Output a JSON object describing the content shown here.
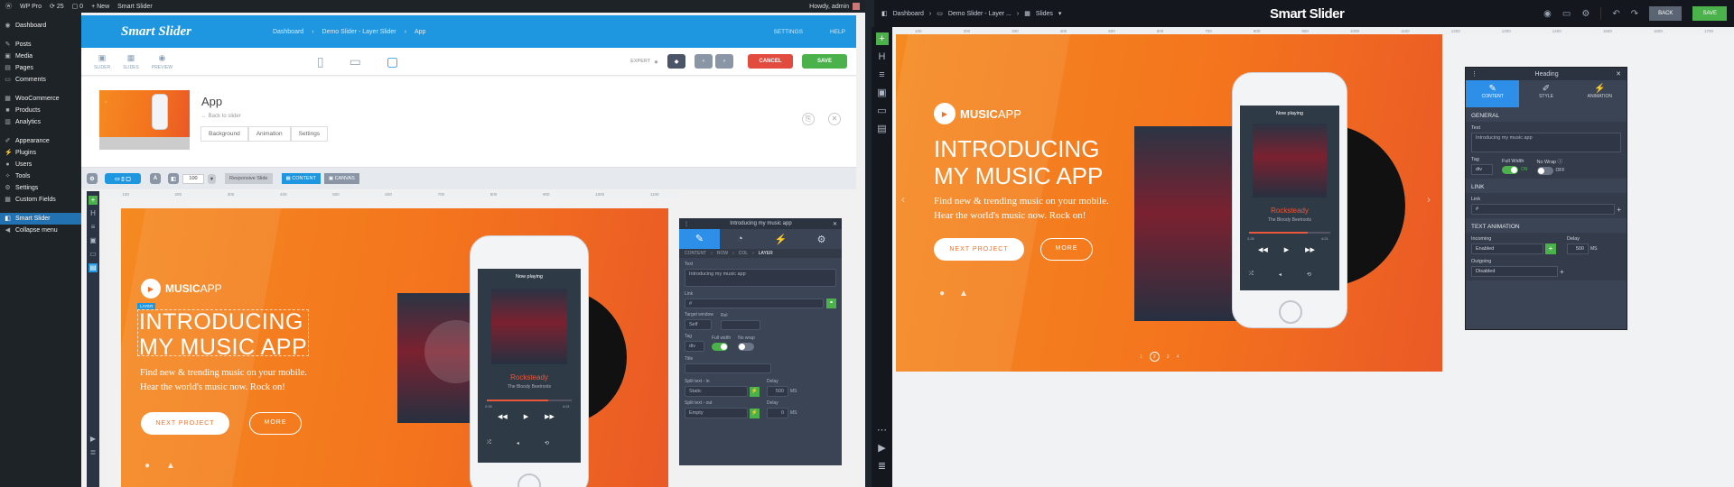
{
  "admin_bar": {
    "site": "WP Pro",
    "updates": "25",
    "comments": "0",
    "new": "New",
    "plugin": "Smart Slider",
    "howdy": "Howdy, admin"
  },
  "wp_menu": [
    {
      "label": "Dashboard",
      "icon": "dashboard-icon"
    },
    {
      "label": "Posts",
      "icon": "pin-icon"
    },
    {
      "label": "Media",
      "icon": "media-icon"
    },
    {
      "label": "Pages",
      "icon": "page-icon"
    },
    {
      "label": "Comments",
      "icon": "comment-icon"
    },
    {
      "label": "WooCommerce",
      "icon": "woo-icon"
    },
    {
      "label": "Products",
      "icon": "box-icon"
    },
    {
      "label": "Analytics",
      "icon": "chart-icon"
    },
    {
      "label": "Appearance",
      "icon": "brush-icon"
    },
    {
      "label": "Plugins",
      "icon": "plug-icon"
    },
    {
      "label": "Users",
      "icon": "user-icon"
    },
    {
      "label": "Tools",
      "icon": "wrench-icon"
    },
    {
      "label": "Settings",
      "icon": "settings-icon"
    },
    {
      "label": "Custom Fields",
      "icon": "grid-icon"
    },
    {
      "label": "Smart Slider",
      "icon": "slider-icon"
    },
    {
      "label": "Collapse menu",
      "icon": "collapse-icon"
    }
  ],
  "left": {
    "logo": "Smart Slider",
    "breadcrumb": [
      "Dashboard",
      "Demo Slider - Layer Slider",
      "App"
    ],
    "settings": "SETTINGS",
    "help": "HELP",
    "tools": [
      "SLIDER",
      "SLIDES",
      "PREVIEW"
    ],
    "expert": "EXPERT",
    "cancel": "CANCEL",
    "save": "SAVE",
    "slide_title": "App",
    "back": "Back to slider",
    "tabs": [
      "Background",
      "Animation",
      "Settings"
    ],
    "zoom": "100",
    "responsive": "Responsive Slide",
    "content_tab": "CONTENT",
    "canvas_tab": "CANVAS",
    "ruler": [
      "100",
      "200",
      "300",
      "400",
      "500",
      "600",
      "700",
      "800",
      "900",
      "1000",
      "1100"
    ],
    "layer_tag": "LAYER"
  },
  "slide": {
    "brand_bold": "MUSIC",
    "brand_light": "APP",
    "headline1": "INTRODUCING",
    "headline2": "MY MUSIC APP",
    "sub1": "Find new & trending music on your mobile.",
    "sub2": "Hear the world's music now. Rock on!",
    "btn_primary": "NEXT PROJECT",
    "btn_secondary": "MORE",
    "now_playing": "Now playing",
    "track": "Rocksteady",
    "artist": "The Bloody Beetroots",
    "time_start": "2:26",
    "time_end": "4:21",
    "album_title": "The Bloody Beetroots"
  },
  "layer_panel": {
    "title": "Introducing my music app",
    "breadcrumb": [
      "CONTENT",
      "ROW",
      "COL",
      "LAYER"
    ],
    "text_label": "Text",
    "text_value": "Introducing my music app",
    "link_label": "Link",
    "link_value": "#",
    "target_label": "Target window",
    "target_value": "Self",
    "rel_label": "Rel",
    "tag_label": "Tag",
    "tag_value": "div",
    "fullwidth_label": "Full width",
    "nowrap_label": "No wrap",
    "title_label": "Title",
    "split_in_label": "Split text - in",
    "split_in_value": "Static",
    "delay_label": "Delay",
    "delay_value": "500",
    "unit": "MS",
    "split_out_label": "Split text - out",
    "split_out_value": "Empty",
    "delay2_value": "0"
  },
  "right": {
    "breadcrumb": [
      "Dashboard",
      "Demo Slider - Layer ...",
      "Slides"
    ],
    "logo": "Smart Slider",
    "back": "BACK",
    "save": "SAVE",
    "ruler": [
      "100",
      "200",
      "300",
      "400",
      "500",
      "600",
      "700",
      "800",
      "900",
      "1000",
      "1100",
      "1200",
      "1300",
      "1400",
      "1500",
      "1600",
      "1700"
    ],
    "bullets": [
      "1",
      "2",
      "3",
      "4"
    ]
  },
  "heading_panel": {
    "title": "Heading",
    "tabs": [
      "CONTENT",
      "STYLE",
      "ANIMATION"
    ],
    "general": "GENERAL",
    "text_label": "Text",
    "text_value": "Introducing my music app",
    "tag_label": "Tag",
    "tag_value": "div",
    "fullwidth_label": "Full Width",
    "fullwidth_state": "ON",
    "nowrap_label": "No Wrap",
    "nowrap_state": "OFF",
    "link_section": "LINK",
    "link_label": "Link",
    "link_value": "#",
    "anim_section": "TEXT ANIMATION",
    "incoming_label": "Incoming",
    "incoming_value": "Enabled",
    "delay_label": "Delay",
    "delay_value": "500",
    "unit": "MS",
    "outgoing_label": "Outgoing",
    "outgoing_value": "Disabled"
  },
  "colors": {
    "wp_dark": "#1d2327",
    "ss_blue": "#1e96e0",
    "cancel_red": "#e24c3e",
    "save_green": "#4bb14b",
    "orange": "#f4741d",
    "panel_dark": "#3b4454",
    "active_blue": "#2d8fe8"
  }
}
